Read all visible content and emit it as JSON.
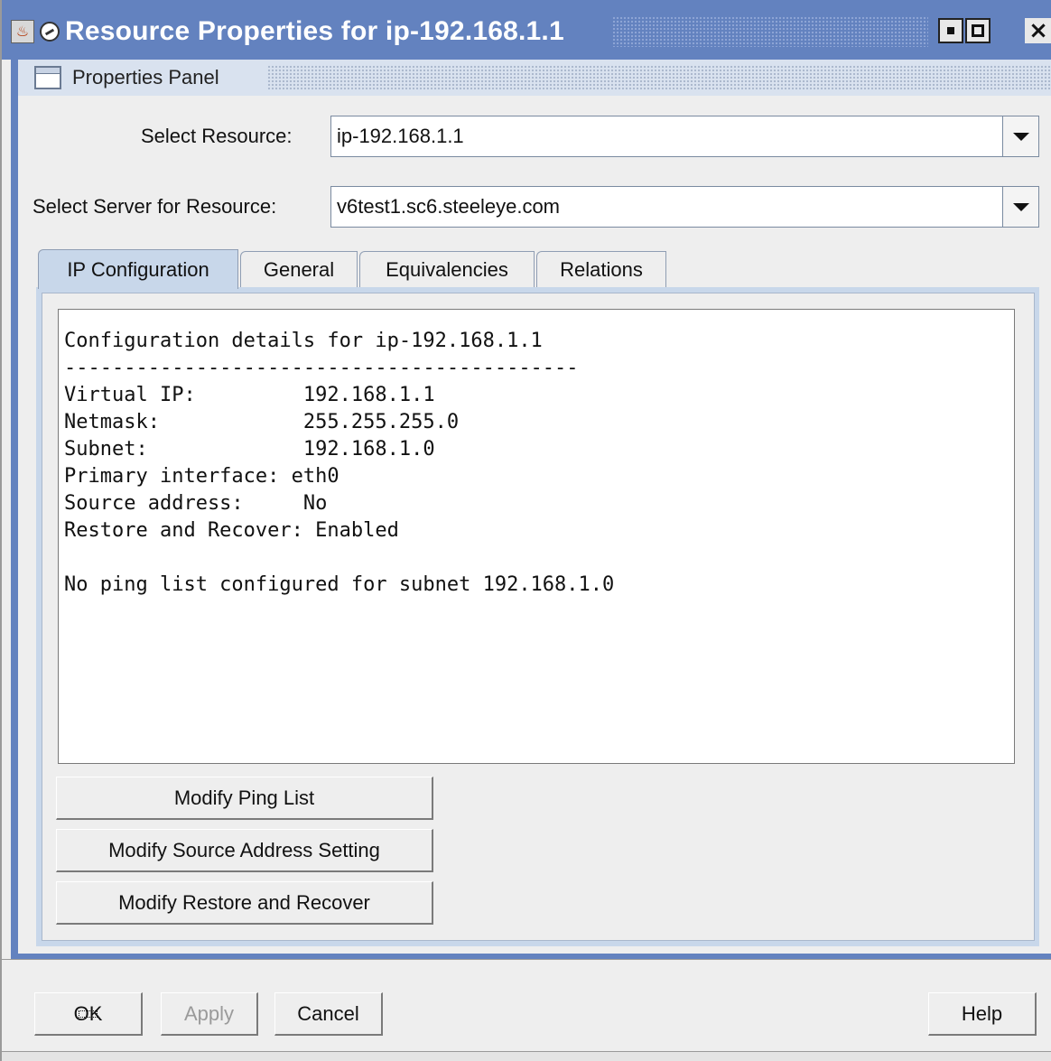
{
  "window": {
    "title": "Resource Properties for ip-192.168.1.1",
    "icons": [
      "java-icon",
      "app-icon"
    ],
    "controls": [
      "minimize-icon",
      "maximize-icon",
      "close-icon"
    ],
    "close_glyph": "×"
  },
  "panel": {
    "title": "Properties Panel",
    "icon": "window-icon"
  },
  "select_resource": {
    "label": "Select Resource:",
    "value": "ip-192.168.1.1"
  },
  "select_server": {
    "label": "Select Server for Resource:",
    "value": "v6test1.sc6.steeleye.com"
  },
  "tabs": [
    {
      "label": "IP Configuration",
      "active": true
    },
    {
      "label": "General",
      "active": false
    },
    {
      "label": "Equivalencies",
      "active": false
    },
    {
      "label": "Relations",
      "active": false
    }
  ],
  "config_text": "Configuration details for ip-192.168.1.1\n-------------------------------------------\nVirtual IP:         192.168.1.1\nNetmask:            255.255.255.0\nSubnet:             192.168.1.0\nPrimary interface: eth0\nSource address:     No\nRestore and Recover: Enabled\n\nNo ping list configured for subnet 192.168.1.0",
  "actions": {
    "modify_ping_list": "Modify Ping List",
    "modify_source_address": "Modify Source Address Setting",
    "modify_restore_recover": "Modify Restore and Recover"
  },
  "dialog_buttons": {
    "ok": "OK",
    "apply": "Apply",
    "cancel": "Cancel",
    "help": "Help"
  },
  "colors": {
    "titlebar": "#6382bf",
    "active_tab": "#c8d7ea"
  }
}
